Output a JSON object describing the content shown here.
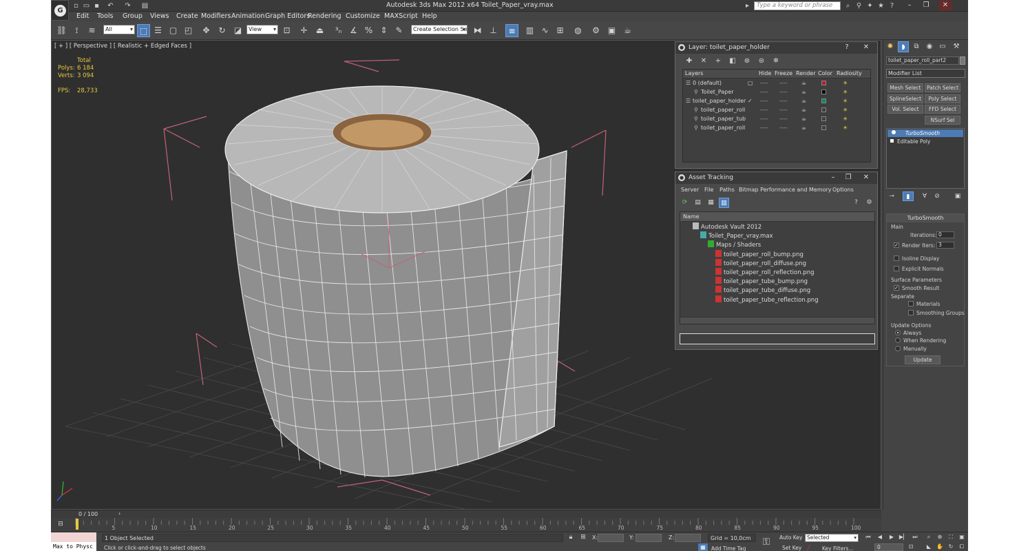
{
  "window": {
    "title": "Autodesk 3ds Max  2012 x64      Toilet_Paper_vray.max",
    "search_placeholder": "Type a keyword or phrase"
  },
  "menu": [
    "Edit",
    "Tools",
    "Group",
    "Views",
    "Create",
    "Modifiers",
    "Animation",
    "Graph Editors",
    "Rendering",
    "Customize",
    "MAXScript",
    "Help"
  ],
  "toolbar": {
    "selection_filter": "All",
    "ref_coord": "View",
    "named_selection": "Create Selection Se"
  },
  "viewport": {
    "label": "[ + ] [ Perspective ] [ Realistic + Edged Faces ]",
    "stats": {
      "total_label": "Total",
      "polys_label": "Polys:",
      "polys_value": "6 184",
      "verts_label": "Verts:",
      "verts_value": "3 094",
      "fps_label": "FPS:",
      "fps_value": "28,733"
    }
  },
  "layer_panel": {
    "title": "Layer: toilet_paper_holder",
    "columns": [
      "Layers",
      "Hide",
      "Freeze",
      "Render",
      "Color",
      "Radiosity"
    ],
    "rows": [
      {
        "name": "0 (default)",
        "indent": 0,
        "color": "#c0143c"
      },
      {
        "name": "Toilet_Paper",
        "indent": 1,
        "color": "#000000"
      },
      {
        "name": "toilet_paper_holder",
        "indent": 0,
        "color": "#0a8a6a"
      },
      {
        "name": "toilet_paper_roll",
        "indent": 1,
        "color": "#3f3f3f"
      },
      {
        "name": "toilet_paper_tub",
        "indent": 1,
        "color": "#3f3f3f"
      },
      {
        "name": "toilet_paper_roll",
        "indent": 1,
        "color": "#3f3f3f"
      }
    ],
    "dash": "----"
  },
  "asset_panel": {
    "title": "Asset Tracking",
    "menu": [
      "Server",
      "File",
      "Paths",
      "Bitmap Performance and Memory",
      "Options"
    ],
    "column": "Name",
    "rows": [
      {
        "name": "Autodesk Vault 2012",
        "level": 0
      },
      {
        "name": "Toilet_Paper_vray.max",
        "level": 1
      },
      {
        "name": "Maps / Shaders",
        "level": 2
      },
      {
        "name": "toilet_paper_roll_bump.png",
        "level": 3
      },
      {
        "name": "toilet_paper_roll_diffuse.png",
        "level": 3
      },
      {
        "name": "toilet_paper_roll_reflection.png",
        "level": 3
      },
      {
        "name": "toilet_paper_tube_bump.png",
        "level": 3
      },
      {
        "name": "toilet_paper_tube_diffuse.png",
        "level": 3
      },
      {
        "name": "toilet_paper_tube_reflection.png",
        "level": 3
      }
    ]
  },
  "command_panel": {
    "object_name": "toilet_paper_roll_part2",
    "modifier_list": "Modifier List",
    "buttons": [
      "Mesh Select",
      "Patch Select",
      "SplineSelect",
      "Poly Select",
      "Vol. Select",
      "FFD Select",
      "NSurf Sel"
    ],
    "stack": [
      "TurboSmooth",
      "Editable Poly"
    ],
    "rollout_title": "TurboSmooth",
    "main_label": "Main",
    "iterations_label": "Iterations:",
    "iterations_value": "0",
    "render_iters_label": "Render Iters:",
    "render_iters_value": "3",
    "isoline": "Isoline Display",
    "explicit_normals": "Explicit Normals",
    "surface_params": "Surface Parameters",
    "smooth_result": "Smooth Result",
    "separate": "Separate",
    "materials": "Materials",
    "smoothing_groups": "Smoothing Groups",
    "update_options": "Update Options",
    "always": "Always",
    "when_rendering": "When Rendering",
    "manually": "Manually",
    "update_btn": "Update"
  },
  "timeline": {
    "frame": "0 / 100",
    "ticks": [
      "5",
      "10",
      "15",
      "20",
      "25",
      "30",
      "35",
      "40",
      "45",
      "50",
      "55",
      "60",
      "65",
      "70",
      "75",
      "80",
      "85",
      "90",
      "95",
      "100"
    ]
  },
  "status": {
    "maxscript": "Max to Physc",
    "selected": "1 Object Selected",
    "prompt": "Click or click-and-drag to select objects",
    "x_label": "X:",
    "y_label": "Y:",
    "z_label": "Z:",
    "grid": "Grid = 10,0cm",
    "add_time_tag": "Add Time Tag",
    "auto_key": "Auto Key",
    "set_key": "Set Key",
    "selected_combo": "Selected",
    "key_filters": "Key Filters...",
    "frame_value": "0"
  }
}
